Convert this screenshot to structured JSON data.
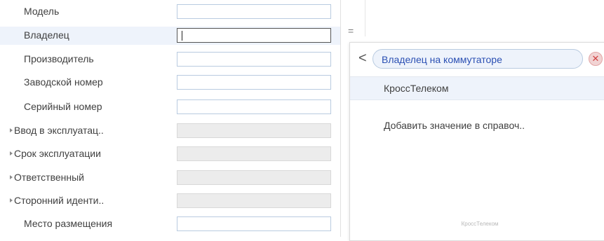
{
  "form": {
    "rows": [
      {
        "label": "Модель",
        "state": "normal"
      },
      {
        "label": "Владелец",
        "state": "active"
      },
      {
        "label": "Производитель",
        "state": "normal"
      },
      {
        "label": "Заводской номер",
        "state": "normal"
      },
      {
        "label": "Серийный номер",
        "state": "normal"
      },
      {
        "label": "Ввод в эксплуатац..",
        "state": "disabled"
      },
      {
        "label": "Срок эксплуатации",
        "state": "disabled"
      },
      {
        "label": "Ответственный",
        "state": "disabled"
      },
      {
        "label": "Сторонний иденти..",
        "state": "disabled"
      },
      {
        "label": "Место размещения",
        "state": "normal"
      }
    ]
  },
  "toolbar": {
    "equals_symbol": "="
  },
  "popup": {
    "back_symbol": "<",
    "search_value": "Владелец на коммутаторе",
    "clear_symbol": "✕",
    "option_label": "КроссТелеком",
    "add_value_label": "Добавить значение в справоч..",
    "watermark": "КроссТелеком"
  },
  "colors": {
    "accent": "#2a4fb3",
    "selected_bg": "#eef3fb",
    "field_border": "#b9cbe0",
    "disabled_bg": "#ececec"
  }
}
